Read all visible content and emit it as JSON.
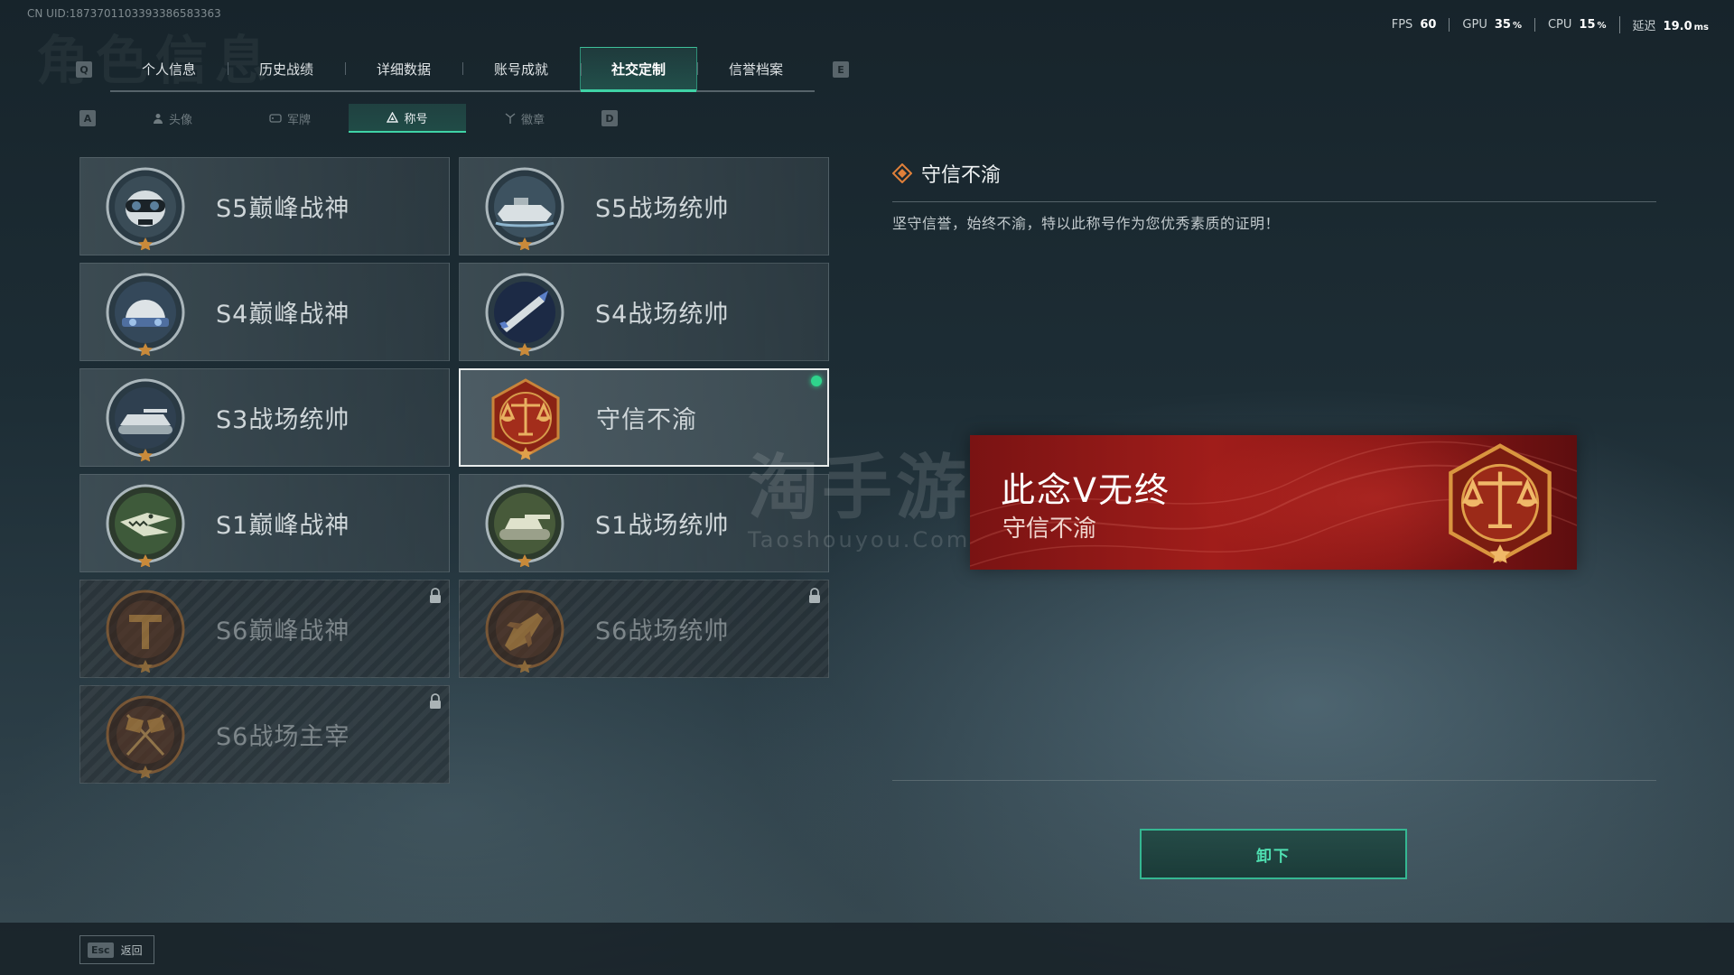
{
  "uid_text": "CN UID:1873701103393386583363",
  "perf": {
    "fps_label": "FPS",
    "fps_value": "60",
    "gpu_label": "GPU",
    "gpu_value": "35",
    "gpu_unit": "%",
    "cpu_label": "CPU",
    "cpu_value": "15",
    "cpu_unit": "%",
    "latency_label": "延迟",
    "latency_value": "19.0",
    "latency_unit": "ms"
  },
  "tabs": {
    "prev_key": "Q",
    "next_key": "E",
    "items": [
      "个人信息",
      "历史战绩",
      "详细数据",
      "账号成就",
      "社交定制",
      "信誉档案"
    ],
    "active_index": 4
  },
  "subtabs": {
    "prev_key": "A",
    "next_key": "D",
    "items": [
      {
        "label": "头像",
        "icon": "person-icon"
      },
      {
        "label": "军牌",
        "icon": "dogtag-icon"
      },
      {
        "label": "称号",
        "icon": "triangle-icon"
      },
      {
        "label": "徽章",
        "icon": "badge-icon"
      }
    ],
    "active_index": 2
  },
  "titles": [
    {
      "label": "S5巅峰战神",
      "emblem": "skull-goggles-emblem",
      "locked": false
    },
    {
      "label": "S5战场统帅",
      "emblem": "boat-emblem",
      "locked": false
    },
    {
      "label": "S4巅峰战神",
      "emblem": "helmet-nightvision-emblem",
      "locked": false
    },
    {
      "label": "S4战场统帅",
      "emblem": "missile-emblem",
      "locked": false
    },
    {
      "label": "S3战场统帅",
      "emblem": "armored-vehicle-emblem",
      "locked": false
    },
    {
      "label": "守信不渝",
      "emblem": "scales-emblem",
      "locked": false,
      "selected": true,
      "equipped": true
    },
    {
      "label": "S1巅峰战神",
      "emblem": "crocodile-emblem",
      "locked": false
    },
    {
      "label": "S1战场统帅",
      "emblem": "tank-emblem",
      "locked": false
    },
    {
      "label": "S6巅峰战神",
      "emblem": "t-shield-emblem",
      "locked": true
    },
    {
      "label": "S6战场统帅",
      "emblem": "jet-emblem",
      "locked": true
    },
    {
      "label": "S6战场主宰",
      "emblem": "crossed-flags-emblem",
      "locked": true
    }
  ],
  "detail": {
    "title": "守信不渝",
    "description": "坚守信誉，始终不渝，特以此称号作为您优秀素质的证明！",
    "banner_name": "此念ᐯ无终",
    "banner_title": "守信不渝"
  },
  "unequip_label": "卸下",
  "footer": {
    "esc_key": "Esc",
    "esc_label": "返回"
  },
  "watermark": {
    "cn": "淘手游",
    "en": "Taoshouyou.Com"
  },
  "colors": {
    "accent": "#3fd3a6",
    "banner_red": "#a01d1a",
    "equipped_dot": "#2fd48c",
    "emblem_bronze": "#b8742e"
  }
}
